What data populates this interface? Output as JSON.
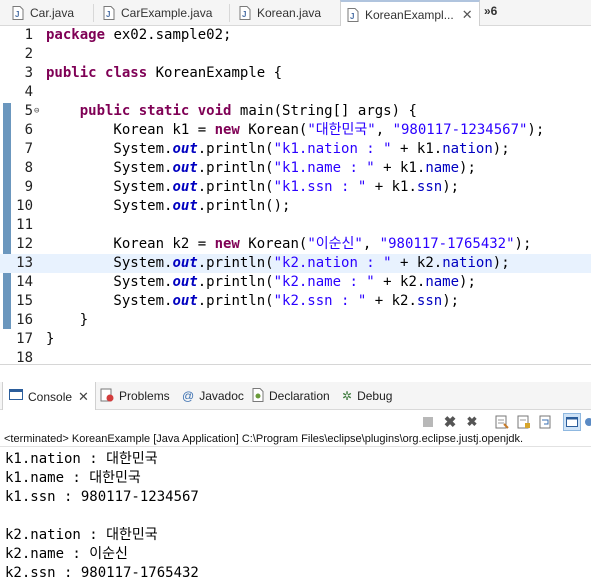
{
  "editor_tabs": [
    {
      "label": "Car.java",
      "active": false
    },
    {
      "label": "CarExample.java",
      "active": false
    },
    {
      "label": "Korean.java",
      "active": false
    },
    {
      "label": "KoreanExampl...",
      "active": true
    }
  ],
  "overflow_indicator": "»6",
  "code": {
    "current_line": 13,
    "lines": [
      {
        "num": "1",
        "tokens": [
          {
            "t": "kw",
            "v": "package"
          },
          {
            "t": "p",
            "v": " ex02.sample02;"
          }
        ]
      },
      {
        "num": "2",
        "tokens": []
      },
      {
        "num": "3",
        "tokens": [
          {
            "t": "kw",
            "v": "public"
          },
          {
            "t": "p",
            "v": " "
          },
          {
            "t": "kw",
            "v": "class"
          },
          {
            "t": "p",
            "v": " KoreanExample {"
          }
        ]
      },
      {
        "num": "4",
        "tokens": []
      },
      {
        "num": "5",
        "fold": "⊖",
        "tokens": [
          {
            "t": "p",
            "v": "    "
          },
          {
            "t": "kw",
            "v": "public"
          },
          {
            "t": "p",
            "v": " "
          },
          {
            "t": "kw",
            "v": "static"
          },
          {
            "t": "p",
            "v": " "
          },
          {
            "t": "kw",
            "v": "void"
          },
          {
            "t": "p",
            "v": " main(String[] args) {"
          }
        ]
      },
      {
        "num": "6",
        "tokens": [
          {
            "t": "p",
            "v": "        Korean k1 = "
          },
          {
            "t": "kw",
            "v": "new"
          },
          {
            "t": "p",
            "v": " Korean("
          },
          {
            "t": "str",
            "v": "\"대한민국\""
          },
          {
            "t": "p",
            "v": ", "
          },
          {
            "t": "str",
            "v": "\"980117-1234567\""
          },
          {
            "t": "p",
            "v": ");"
          }
        ]
      },
      {
        "num": "7",
        "tokens": [
          {
            "t": "p",
            "v": "        System."
          },
          {
            "t": "stat",
            "v": "out"
          },
          {
            "t": "p",
            "v": ".println("
          },
          {
            "t": "str",
            "v": "\"k1.nation : \""
          },
          {
            "t": "p",
            "v": " + k1."
          },
          {
            "t": "fld",
            "v": "nation"
          },
          {
            "t": "p",
            "v": ");"
          }
        ]
      },
      {
        "num": "8",
        "tokens": [
          {
            "t": "p",
            "v": "        System."
          },
          {
            "t": "stat",
            "v": "out"
          },
          {
            "t": "p",
            "v": ".println("
          },
          {
            "t": "str",
            "v": "\"k1.name : \""
          },
          {
            "t": "p",
            "v": " + k1."
          },
          {
            "t": "fld",
            "v": "name"
          },
          {
            "t": "p",
            "v": ");"
          }
        ]
      },
      {
        "num": "9",
        "tokens": [
          {
            "t": "p",
            "v": "        System."
          },
          {
            "t": "stat",
            "v": "out"
          },
          {
            "t": "p",
            "v": ".println("
          },
          {
            "t": "str",
            "v": "\"k1.ssn : \""
          },
          {
            "t": "p",
            "v": " + k1."
          },
          {
            "t": "fld",
            "v": "ssn"
          },
          {
            "t": "p",
            "v": ");"
          }
        ]
      },
      {
        "num": "10",
        "tokens": [
          {
            "t": "p",
            "v": "        System."
          },
          {
            "t": "stat",
            "v": "out"
          },
          {
            "t": "p",
            "v": ".println();"
          }
        ]
      },
      {
        "num": "11",
        "tokens": []
      },
      {
        "num": "12",
        "tokens": [
          {
            "t": "p",
            "v": "        Korean k2 = "
          },
          {
            "t": "kw",
            "v": "new"
          },
          {
            "t": "p",
            "v": " Korean("
          },
          {
            "t": "str",
            "v": "\"이순신\""
          },
          {
            "t": "p",
            "v": ", "
          },
          {
            "t": "str",
            "v": "\"980117-1765432\""
          },
          {
            "t": "p",
            "v": ");"
          }
        ]
      },
      {
        "num": "13",
        "tokens": [
          {
            "t": "p",
            "v": "        System."
          },
          {
            "t": "stat",
            "v": "out"
          },
          {
            "t": "p",
            "v": ".println("
          },
          {
            "t": "str",
            "v": "\"k2.nation : \""
          },
          {
            "t": "p",
            "v": " + k2."
          },
          {
            "t": "fld",
            "v": "nation"
          },
          {
            "t": "p",
            "v": ");"
          }
        ]
      },
      {
        "num": "14",
        "tokens": [
          {
            "t": "p",
            "v": "        System."
          },
          {
            "t": "stat",
            "v": "out"
          },
          {
            "t": "p",
            "v": ".println("
          },
          {
            "t": "str",
            "v": "\"k2.name : \""
          },
          {
            "t": "p",
            "v": " + k2."
          },
          {
            "t": "fld",
            "v": "name"
          },
          {
            "t": "p",
            "v": ");"
          }
        ]
      },
      {
        "num": "15",
        "tokens": [
          {
            "t": "p",
            "v": "        System."
          },
          {
            "t": "stat",
            "v": "out"
          },
          {
            "t": "p",
            "v": ".println("
          },
          {
            "t": "str",
            "v": "\"k2.ssn : \""
          },
          {
            "t": "p",
            "v": " + k2."
          },
          {
            "t": "fld",
            "v": "ssn"
          },
          {
            "t": "p",
            "v": ");"
          }
        ]
      },
      {
        "num": "16",
        "tokens": [
          {
            "t": "p",
            "v": "    }"
          }
        ]
      },
      {
        "num": "17",
        "tokens": [
          {
            "t": "p",
            "v": "}"
          }
        ]
      },
      {
        "num": "18",
        "tokens": []
      }
    ]
  },
  "view_tabs": [
    {
      "label": "Console",
      "icon": "console-icon",
      "active": true
    },
    {
      "label": "Problems",
      "icon": "problems-icon",
      "active": false
    },
    {
      "label": "Javadoc",
      "icon": "javadoc-icon",
      "active": false
    },
    {
      "label": "Declaration",
      "icon": "declaration-icon",
      "active": false
    },
    {
      "label": "Debug",
      "icon": "debug-icon",
      "active": false
    }
  ],
  "console": {
    "status": "<terminated> KoreanExample [Java Application] C:\\Program Files\\eclipse\\plugins\\org.eclipse.justj.openjdk.",
    "output": [
      "k1.nation : 대한민국",
      "k1.name : 대한민국",
      "k1.ssn : 980117-1234567",
      "",
      "k2.nation : 대한민국",
      "k2.name : 이순신",
      "k2.ssn : 980117-1765432"
    ]
  },
  "colors": {
    "keyword": "#7f0055",
    "string": "#2a00ff",
    "field": "#0000c0",
    "current_line": "#e8f2fe",
    "change_bar": "#6b97be"
  }
}
